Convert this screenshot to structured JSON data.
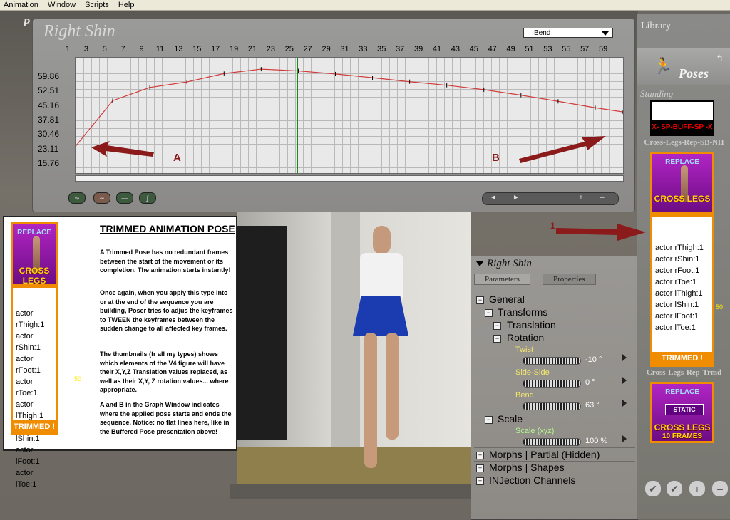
{
  "menu": [
    "Animation",
    "Window",
    "Scripts",
    "Help"
  ],
  "corner_label": "P",
  "graph": {
    "title": "Right Shin",
    "dropdown": "Bend",
    "frames": [
      "1",
      "3",
      "5",
      "7",
      "9",
      "11",
      "13",
      "15",
      "17",
      "19",
      "21",
      "23",
      "25",
      "27",
      "29",
      "31",
      "33",
      "35",
      "37",
      "39",
      "41",
      "43",
      "45",
      "47",
      "49",
      "51",
      "53",
      "55",
      "57",
      "59"
    ],
    "ylabels": [
      "59.86",
      "52.51",
      "45.16",
      "37.81",
      "30.46",
      "23.11",
      "15.76"
    ],
    "marker_a": "A",
    "marker_b": "B",
    "timeline_buttons": [
      "◄",
      "►",
      "+",
      "–"
    ],
    "curve_buttons": [
      "∿",
      "∼",
      "—",
      "∫"
    ],
    "colors": {
      "curve": "#d23a3a",
      "current_frame": "#1f8a1f"
    }
  },
  "library": {
    "title": "Library",
    "category": "Poses",
    "section": "Standing",
    "item1": {
      "top": "X- SP-BUFF-SP -X",
      "caption": "Cross-Legs-Rep-SB-NH"
    },
    "item2": {
      "replace": "REPLACE",
      "label": "CROSS LEGS",
      "actors": [
        "actor rThigh:1",
        "actor rShin:1",
        "actor rFoot:1",
        "actor rToe:1",
        "actor lThigh:1",
        "actor lShin:1",
        "actor lFoot:1",
        "actor lToe:1"
      ],
      "tag": "TRIMMED !",
      "side_num": "50",
      "caption": "Cross-Legs-Rep-Trmd"
    },
    "item3": {
      "replace": "REPLACE",
      "static": "STATIC",
      "label": "CROSS LEGS",
      "frames": "10 FRAMES"
    },
    "pointer": "1",
    "bottom_buttons": [
      "✔",
      "✔",
      "+",
      "–"
    ]
  },
  "info": {
    "thumb_replace": "REPLACE",
    "thumb_label": "CROSS LEGS",
    "actors": [
      "actor rThigh:1",
      "actor rShin:1",
      "actor rFoot:1",
      "actor rToe:1",
      "actor lThigh:1",
      "actor lShin:1",
      "actor lFoot:1",
      "actor lToe:1"
    ],
    "tag": "TRIMMED !",
    "side_num": "50",
    "title": "TRIMMED ANIMATION POSE",
    "p1": "A Trimmed Pose has no redundant frames between the start of the movement or its completion. The animation starts instantly!",
    "p2": "Once again, when you apply this type into or at the end of the sequence you are building, Poser tries to adjus the keyframes to TWEEN the keyframes between the sudden change to all affected key frames.",
    "p3": "The thumbnails (fr all my types) shows which elements of the V4 figure will have their X,Y,Z Translation values replaced, as well as their X,Y, Z rotation values... where appropriate.",
    "p4": "A and B in the Graph Window indicates where the applied pose starts and ends the sequence. Notice: no flat lines here, like in the Buffered Pose presentation above!"
  },
  "params": {
    "title": "Right Shin",
    "tabs": [
      "Parameters",
      "Properties"
    ],
    "general": "General",
    "transforms": "Transforms",
    "translation": "Translation",
    "rotation": "Rotation",
    "twist_label": "Twist",
    "twist_value": "-10 °",
    "side_label": "Side-Side",
    "side_value": "0 °",
    "bend_label": "Bend",
    "bend_value": "63 °",
    "scale": "Scale",
    "scale_label": "Scale (xyz)",
    "scale_value": "100 %",
    "morphs_partial": "Morphs | Partial (Hidden)",
    "morphs_shapes": "Morphs | Shapes",
    "injection": "INJection Channels"
  },
  "chart_data": {
    "type": "line",
    "title": "Right Shin",
    "ylabel": "Bend",
    "x": [
      1,
      5,
      9,
      13,
      17,
      21,
      25,
      29,
      33,
      37,
      41,
      45,
      49,
      53,
      57,
      60
    ],
    "y": [
      23.8,
      44.5,
      50.5,
      53.0,
      56.8,
      58.8,
      58.0,
      56.6,
      54.9,
      53.1,
      51.5,
      49.5,
      47.0,
      44.2,
      41.3,
      39.4
    ],
    "xlim": [
      1,
      60
    ],
    "ylim": [
      11,
      64
    ]
  }
}
